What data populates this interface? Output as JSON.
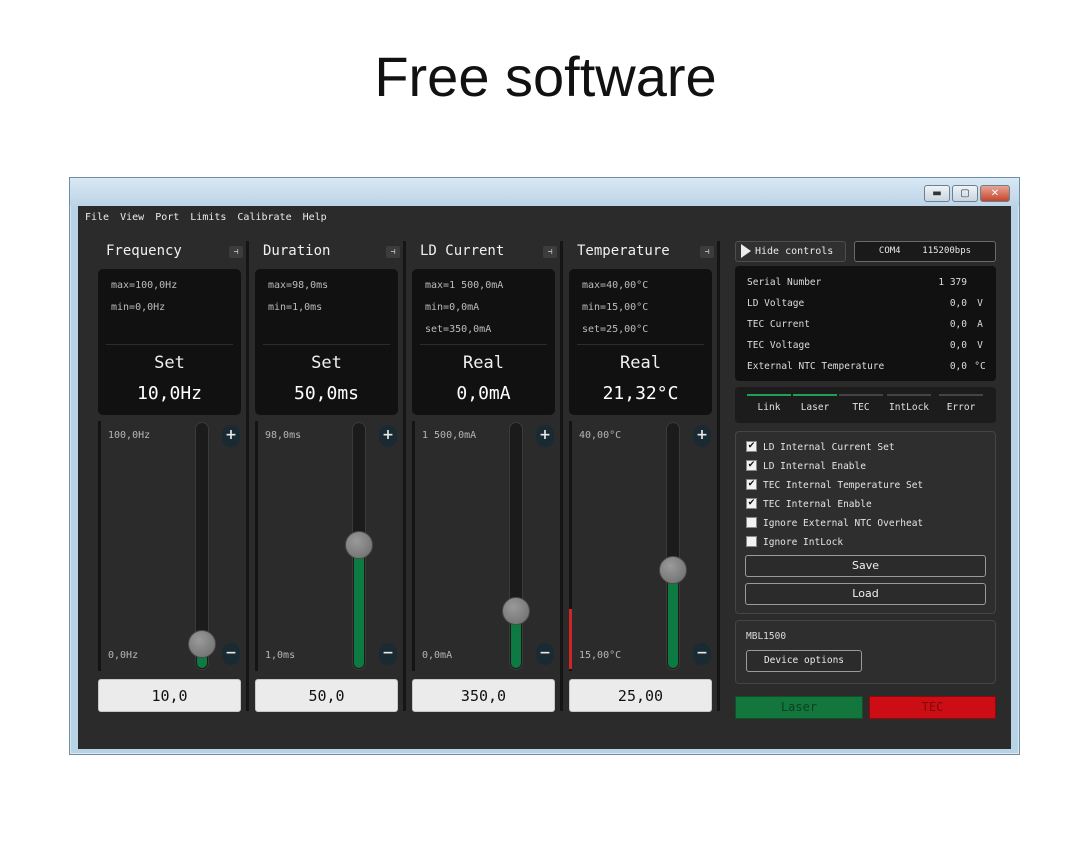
{
  "headline": "Free software",
  "menu": [
    "File",
    "View",
    "Port",
    "Limits",
    "Calibrate",
    "Help"
  ],
  "window_buttons": {
    "minimize": "▬",
    "maximize": "▢",
    "close": "✕"
  },
  "columns": [
    {
      "title": "Frequency",
      "max": "max=100,0Hz",
      "min": "min=0,0Hz",
      "set": "",
      "mode": "Set",
      "value": "10,0Hz",
      "slider_max": "100,0Hz",
      "slider_min": "0,0Hz",
      "slider_fraction": 0.1,
      "input_value": "10,0"
    },
    {
      "title": "Duration",
      "max": "max=98,0ms",
      "min": "min=1,0ms",
      "set": "",
      "mode": "Set",
      "value": "50,0ms",
      "slider_max": "98,0ms",
      "slider_min": "1,0ms",
      "slider_fraction": 0.505,
      "input_value": "50,0"
    },
    {
      "title": "LD Current",
      "max": "max=1 500,0mA",
      "min": "min=0,0mA",
      "set": "set=350,0mA",
      "mode": "Real",
      "value": "0,0mA",
      "slider_max": "1 500,0mA",
      "slider_min": "0,0mA",
      "slider_fraction": 0.233,
      "input_value": "350,0"
    },
    {
      "title": "Temperature",
      "max": "max=40,00°C",
      "min": "min=15,00°C",
      "set": "set=25,00°C",
      "mode": "Real",
      "value": "21,32°C",
      "slider_max": "40,00°C",
      "slider_min": "15,00°C",
      "slider_fraction": 0.4,
      "input_value": "25,00"
    }
  ],
  "stepper": {
    "plus": "+",
    "minus": "−",
    "pin": "⊣"
  },
  "controls": {
    "hide_label": "Hide controls",
    "com_port": "COM4",
    "baud": "115200bps"
  },
  "readings": [
    {
      "label": "Serial Number",
      "value": "1 379",
      "unit": ""
    },
    {
      "label": "LD Voltage",
      "value": "0,0",
      "unit": "V"
    },
    {
      "label": "TEC Current",
      "value": "0,0",
      "unit": "A"
    },
    {
      "label": "TEC Voltage",
      "value": "0,0",
      "unit": "V"
    },
    {
      "label": "External NTC Temperature",
      "value": "0,0",
      "unit": "°C"
    }
  ],
  "status": [
    {
      "label": "Link",
      "on": true
    },
    {
      "label": "Laser",
      "on": true
    },
    {
      "label": "TEC",
      "on": false
    },
    {
      "label": "IntLock",
      "on": false
    },
    {
      "label": "Error",
      "on": false
    }
  ],
  "options": [
    {
      "label": "LD Internal Current Set",
      "checked": true
    },
    {
      "label": "LD Internal Enable",
      "checked": true
    },
    {
      "label": "TEC Internal Temperature Set",
      "checked": true
    },
    {
      "label": "TEC Internal Enable",
      "checked": true
    },
    {
      "label": "Ignore External NTC Overheat",
      "checked": false
    },
    {
      "label": "Ignore IntLock",
      "checked": false
    }
  ],
  "save_label": "Save",
  "load_label": "Load",
  "device": {
    "name": "MBL1500",
    "options_label": "Device options"
  },
  "laser_label": "Laser",
  "tec_label": "TEC",
  "colors": {
    "fill_green": "#0d7a42",
    "laser_green": "#13773d",
    "tec_red": "#cc0e14",
    "panel_dark": "#111111"
  }
}
